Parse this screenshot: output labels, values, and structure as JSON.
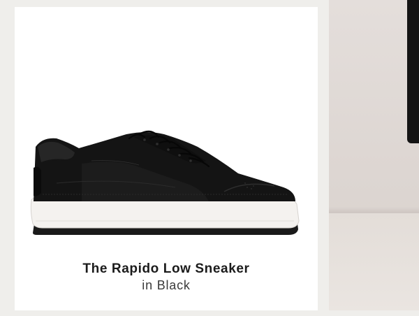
{
  "product": {
    "title": "The Rapido Low Sneaker",
    "color": "in Black",
    "image_icon": "sneaker-product-image"
  },
  "colors": {
    "page_background": "#efeeeb",
    "card_background": "#ffffff",
    "title_text": "#1b1b1b",
    "shoe_upper": "#121212",
    "shoe_sole": "#f3f1ee"
  }
}
